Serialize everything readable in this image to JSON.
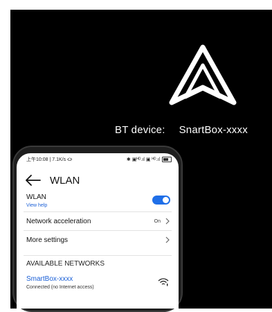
{
  "banner": {
    "bt_key": "BT device:",
    "bt_value": "SnartBox-xxxx"
  },
  "status_bar": {
    "left": "上午10:08 | 7.1K/s ⛮",
    "right": "✱ ▣ᴴᴰ.ıl ▣ ᴴᴰ.ıl"
  },
  "wlan_screen": {
    "title": "WLAN",
    "wlan_label": "WLAN",
    "view_help": "View help",
    "wlan_enabled": true,
    "network_acceleration_label": "Network acceleration",
    "network_acceleration_value": "On",
    "more_settings_label": "More settings",
    "available_networks_header": "AVAILABLE NETWORKS",
    "networks": [
      {
        "name": "SmartBox-xxxx",
        "status": "Connected (no Internet access)"
      }
    ]
  },
  "colors": {
    "accent": "#1f6fe8",
    "link": "#1a5fd6",
    "banner_bg": "#000000"
  },
  "icons": [
    "smartbox-logo-icon",
    "back-arrow-icon",
    "chevron-right-icon",
    "wifi-icon",
    "bluetooth-icon",
    "battery-icon"
  ]
}
